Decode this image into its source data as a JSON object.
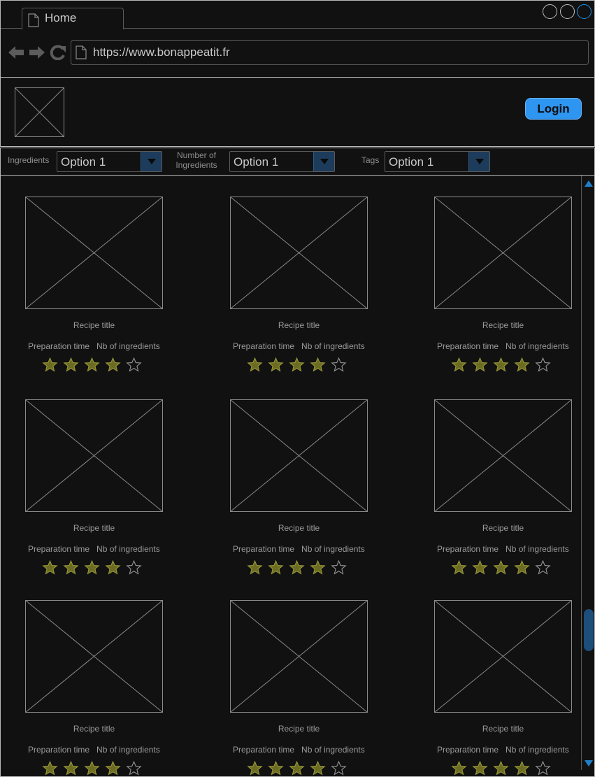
{
  "browser": {
    "tab_label": "Home",
    "url": "https://www.bonappeatit.fr"
  },
  "header": {
    "login_label": "Login"
  },
  "filters": {
    "ingredients": {
      "label": "Ingredients",
      "value": "Option 1"
    },
    "number_of_ingredients": {
      "label": "Number of Ingredients",
      "value": "Option 1"
    },
    "tags": {
      "label": "Tags",
      "value": "Option 1"
    }
  },
  "recipes": [
    {
      "title": "Recipe title",
      "prep": "Preparation time",
      "ingredients": "Nb of ingredients",
      "rating": 4,
      "max_rating": 5
    },
    {
      "title": "Recipe title",
      "prep": "Preparation time",
      "ingredients": "Nb of ingredients",
      "rating": 4,
      "max_rating": 5
    },
    {
      "title": "Recipe title",
      "prep": "Preparation time",
      "ingredients": "Nb of ingredients",
      "rating": 4,
      "max_rating": 5
    },
    {
      "title": "Recipe title",
      "prep": "Preparation time",
      "ingredients": "Nb of ingredients",
      "rating": 4,
      "max_rating": 5
    },
    {
      "title": "Recipe title",
      "prep": "Preparation time",
      "ingredients": "Nb of ingredients",
      "rating": 4,
      "max_rating": 5
    },
    {
      "title": "Recipe title",
      "prep": "Preparation time",
      "ingredients": "Nb of ingredients",
      "rating": 4,
      "max_rating": 5
    },
    {
      "title": "Recipe title",
      "prep": "Preparation time",
      "ingredients": "Nb of ingredients",
      "rating": 4,
      "max_rating": 5
    },
    {
      "title": "Recipe title",
      "prep": "Preparation time",
      "ingredients": "Nb of ingredients",
      "rating": 4,
      "max_rating": 5
    },
    {
      "title": "Recipe title",
      "prep": "Preparation time",
      "ingredients": "Nb of ingredients",
      "rating": 4,
      "max_rating": 5
    }
  ],
  "colors": {
    "accent": "#2e95f0",
    "star_filled": "#6b6b22",
    "star_outline": "#9a9a9a",
    "background": "#111111"
  },
  "icons": {
    "tab": "page-icon",
    "back": "arrow-left-icon",
    "forward": "arrow-right-icon",
    "reload": "reload-icon",
    "logo": "image-placeholder-icon",
    "dropdown": "chevron-down-icon",
    "rating": "star-icon"
  }
}
